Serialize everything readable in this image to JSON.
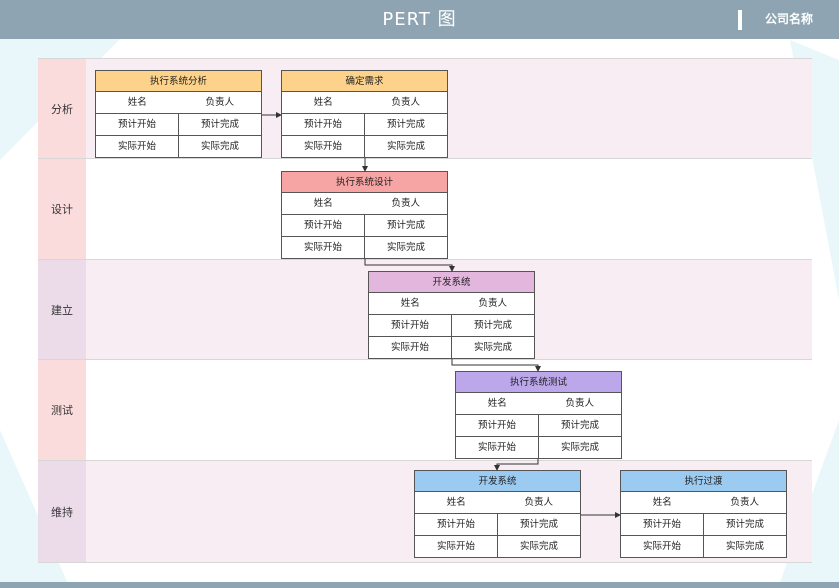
{
  "header": {
    "title": "PERT 图",
    "company": "公司名称"
  },
  "lanes": [
    {
      "label": "分析"
    },
    {
      "label": "设计"
    },
    {
      "label": "建立"
    },
    {
      "label": "测试"
    },
    {
      "label": "维持"
    }
  ],
  "tasks": [
    {
      "name": "执行系统分析",
      "color": "#fdd28a"
    },
    {
      "name": "确定需求",
      "color": "#fdd28a"
    },
    {
      "name": "执行系统设计",
      "color": "#f6a4a4"
    },
    {
      "name": "开发系统",
      "color": "#e2b6dd"
    },
    {
      "name": "执行系统测试",
      "color": "#bba7ea"
    },
    {
      "name": "开发系统",
      "color": "#9ccbf2"
    },
    {
      "name": "执行过渡",
      "color": "#9ccbf2"
    }
  ],
  "task_fields": {
    "name": "姓名",
    "owner": "负责人",
    "planned_start": "预计开始",
    "planned_finish": "预计完成",
    "actual_start": "实际开始",
    "actual_finish": "实际完成"
  }
}
